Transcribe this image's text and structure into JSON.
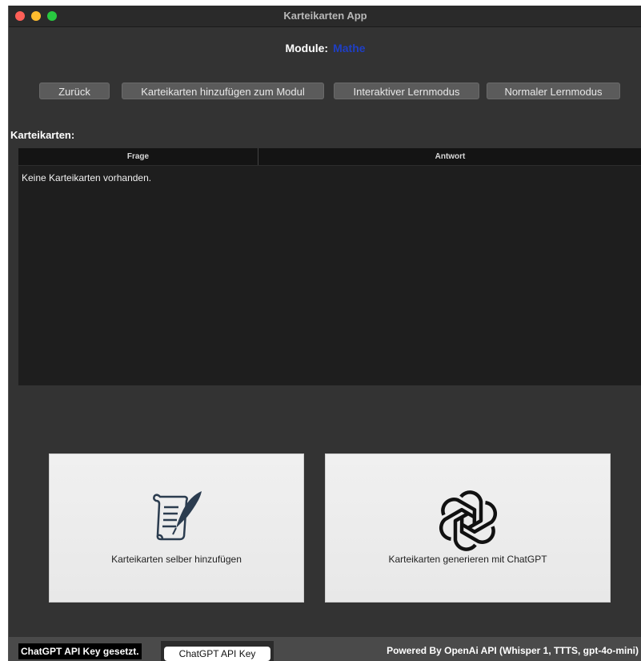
{
  "window": {
    "title": "Karteikarten App"
  },
  "module": {
    "label": "Module:",
    "name": "Mathe"
  },
  "toolbar": {
    "back": "Zurück",
    "add_cards": "Karteikarten hinzufügen zum Modul",
    "interactive_mode": "Interaktiver Lernmodus",
    "normal_mode": "Normaler Lernmodus"
  },
  "cards_section": {
    "title": "Karteikarten:",
    "columns": [
      "Frage",
      "Antwort"
    ],
    "empty_message": "Keine Karteikarten vorhanden."
  },
  "actions": {
    "manual_label": "Karteikarten selber hinzufügen",
    "manual_icon": "scroll-quill-icon",
    "chatgpt_label": "Karteikarten generieren mit ChatGPT",
    "chatgpt_icon": "openai-logo-icon"
  },
  "status": {
    "api_key_status": "ChatGPT API Key gesetzt.",
    "api_key_button": "ChatGPT API Key",
    "powered_by": "Powered By OpenAi API (Whisper 1, TTTS, gpt-4o-mini)"
  },
  "colors": {
    "background": "#333333",
    "module_name": "#1f3fc4",
    "button": "#5b5b5b",
    "table": "#1e1e1e",
    "card": "#f0f0f0"
  }
}
